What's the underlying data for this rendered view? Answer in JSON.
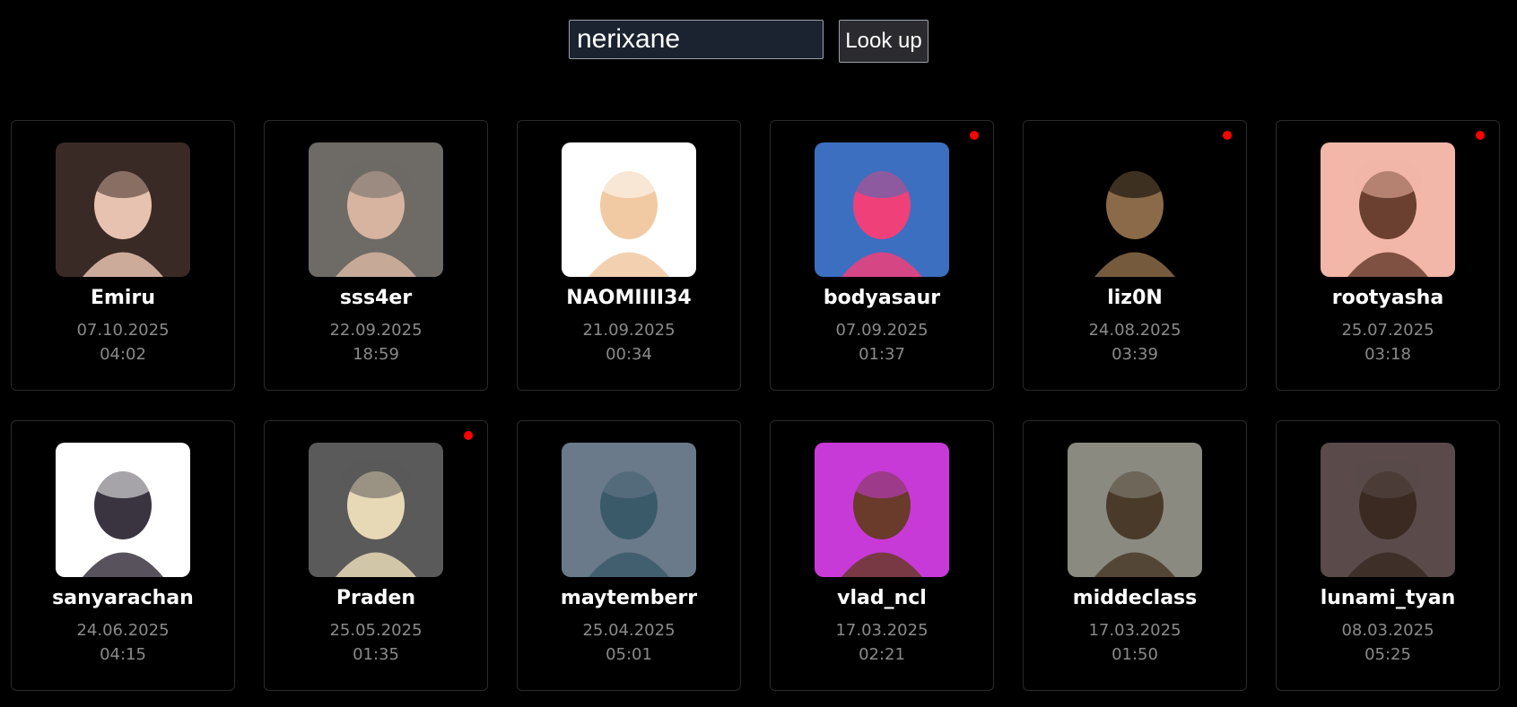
{
  "search": {
    "value": "nerixane",
    "button_label": "Look up"
  },
  "cards": [
    {
      "name": "Emiru",
      "date": "07.10.2025",
      "time": "04:02",
      "live": false,
      "avatar_bg": "#3a2a26",
      "avatar_fg": "#e8c2b0",
      "avatar_icon": "portrait-icon"
    },
    {
      "name": "sss4er",
      "date": "22.09.2025",
      "time": "18:59",
      "live": false,
      "avatar_bg": "#6e6a66",
      "avatar_fg": "#d6b4a0",
      "avatar_icon": "portrait-icon"
    },
    {
      "name": "NAOMIIII34",
      "date": "21.09.2025",
      "time": "00:34",
      "live": false,
      "avatar_bg": "#ffffff",
      "avatar_fg": "#f1c9a2",
      "avatar_icon": "cartoon-icon"
    },
    {
      "name": "bodyasaur",
      "date": "07.09.2025",
      "time": "01:37",
      "live": true,
      "avatar_bg": "#3c6fbf",
      "avatar_fg": "#f0407a",
      "avatar_icon": "mask-icon"
    },
    {
      "name": "liz0N",
      "date": "24.08.2025",
      "time": "03:39",
      "live": true,
      "avatar_bg": "#000000",
      "avatar_fg": "#8a6a48",
      "avatar_icon": "sloth-icon"
    },
    {
      "name": "rootyasha",
      "date": "25.07.2025",
      "time": "03:18",
      "live": true,
      "avatar_bg": "#f2b7a8",
      "avatar_fg": "#6b4030",
      "avatar_icon": "anime-icon"
    },
    {
      "name": "sanyarachan",
      "date": "24.06.2025",
      "time": "04:15",
      "live": false,
      "avatar_bg": "#ffffff",
      "avatar_fg": "#3a3440",
      "avatar_icon": "anime-icon"
    },
    {
      "name": "Praden",
      "date": "25.05.2025",
      "time": "01:35",
      "live": true,
      "avatar_bg": "#5a5a5a",
      "avatar_fg": "#e8d9b6",
      "avatar_icon": "pallet-icon"
    },
    {
      "name": "maytemberr",
      "date": "25.04.2025",
      "time": "05:01",
      "live": false,
      "avatar_bg": "#6a7a8a",
      "avatar_fg": "#3a5a6a",
      "avatar_icon": "portrait-icon"
    },
    {
      "name": "vlad_ncl",
      "date": "17.03.2025",
      "time": "02:21",
      "live": false,
      "avatar_bg": "#c83ad8",
      "avatar_fg": "#6a3a2a",
      "avatar_icon": "portrait-icon"
    },
    {
      "name": "middeclass",
      "date": "17.03.2025",
      "time": "01:50",
      "live": false,
      "avatar_bg": "#8a8a80",
      "avatar_fg": "#4a3a2a",
      "avatar_icon": "monkey-icon"
    },
    {
      "name": "lunami_tyan",
      "date": "08.03.2025",
      "time": "05:25",
      "live": false,
      "avatar_bg": "#5a4a4a",
      "avatar_fg": "#3a2a22",
      "avatar_icon": "anime-icon"
    }
  ]
}
